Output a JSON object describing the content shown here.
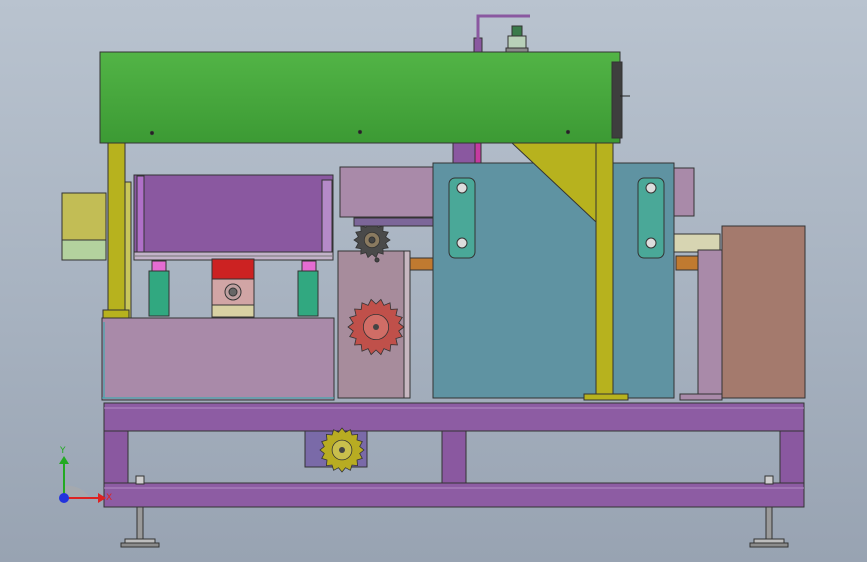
{
  "view": {
    "background": "#a9b4c2",
    "triad": {
      "x_label": "X",
      "y_label": "Y"
    }
  },
  "colors": {
    "frame": "#8a58a0",
    "frame_dark": "#6e4284",
    "hood": "#44a63a",
    "column": "#b7b21e",
    "housing_blue": "#5f93a2",
    "housing_teal": "#4aa898",
    "box_brown": "#a47a6d",
    "box_pink": "#a98aa9",
    "sprocket_red": "#c0504a",
    "sprocket_olive": "#b8ac22",
    "bearing_red": "#cc2222",
    "axis_x": "#dd2222",
    "axis_y": "#22aa22",
    "axis_z": "#2233dd"
  },
  "parts": [
    {
      "name": "top-hood",
      "icon": "rectangle-green"
    },
    {
      "name": "guide-column-left",
      "icon": "column-yellow"
    },
    {
      "name": "guide-column-right",
      "icon": "column-yellow"
    },
    {
      "name": "gusset-bracket",
      "icon": "triangle-yellow"
    },
    {
      "name": "gear-housing",
      "icon": "box-blue"
    },
    {
      "name": "drive-sprocket",
      "icon": "sprocket-red"
    },
    {
      "name": "lower-sprocket",
      "icon": "sprocket-olive"
    },
    {
      "name": "side-cabinet",
      "icon": "box-brown"
    },
    {
      "name": "base-frame",
      "icon": "frame-purple"
    },
    {
      "name": "leveling-feet",
      "icon": "foot"
    },
    {
      "name": "pillow-block-bearing",
      "icon": "bearing-red"
    },
    {
      "name": "top-motor",
      "icon": "motor"
    }
  ]
}
